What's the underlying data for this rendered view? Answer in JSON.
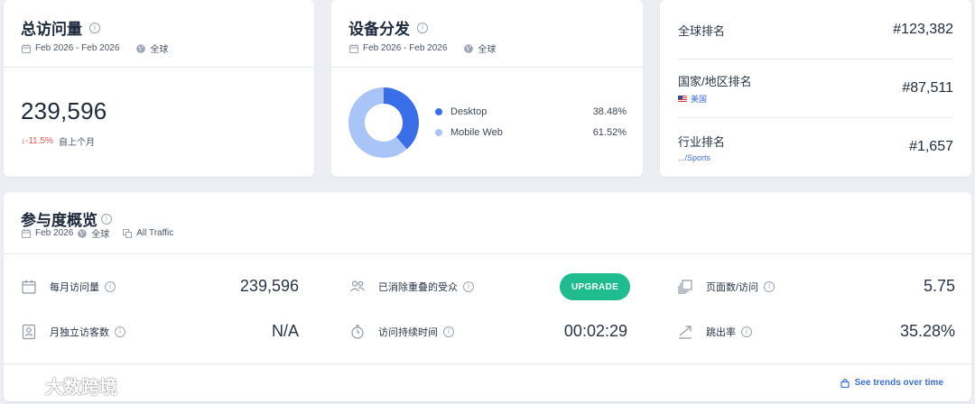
{
  "visits": {
    "title": "总访问量",
    "date_range": "Feb 2026 - Feb 2026",
    "region": "全球",
    "total": "239,596",
    "change": "↓-11.5%",
    "change_label": "自上个月"
  },
  "device": {
    "title": "设备分发",
    "date_range": "Feb 2026 - Feb 2026",
    "region": "全球",
    "items": [
      {
        "name": "Desktop",
        "value": "38.48%",
        "fraction": 0.3848,
        "color": "#3a6ee8"
      },
      {
        "name": "Mobile Web",
        "value": "61.52%",
        "fraction": 0.6152,
        "color": "#a9c4f7"
      }
    ]
  },
  "rank": {
    "global_label": "全球排名",
    "global_value": "#123,382",
    "country_label": "国家/地区排名",
    "country_sub": "美国",
    "country_value": "#87,511",
    "industry_label": "行业排名",
    "industry_sub": ".../Sports",
    "industry_value": "#1,657"
  },
  "engagement": {
    "title": "参与度概览",
    "date": "Feb 2026",
    "region": "全球",
    "traffic": "All Traffic",
    "monthly_visits_label": "每月访问量",
    "monthly_visits_value": "239,596",
    "unique_visitors_label": "月独立访客数",
    "unique_visitors_value": "N/A",
    "dedup_audience_label": "已消除重叠的受众",
    "upgrade_label": "UPGRADE",
    "visit_duration_label": "访问持续时间",
    "visit_duration_value": "00:02:29",
    "pages_per_visit_label": "页面数/访问",
    "pages_per_visit_value": "5.75",
    "bounce_rate_label": "跳出率",
    "bounce_rate_value": "35.28%",
    "trends_link": "See trends over time"
  },
  "watermark": {
    "text": "大数跨境"
  },
  "colors": {
    "accent_blue": "#3a6ee8",
    "upgrade_green": "#1ebc8e",
    "negative_red": "#e8554e",
    "link_blue": "#3d6fd9"
  }
}
